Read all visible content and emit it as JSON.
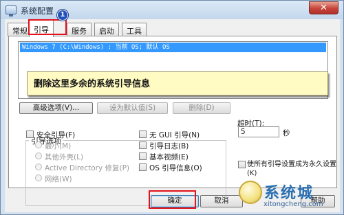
{
  "window": {
    "title": "系统配置",
    "close_glyph": "✕"
  },
  "tabs": [
    {
      "label": "常规",
      "active": false
    },
    {
      "label": "引导",
      "active": true
    },
    {
      "label": "服务",
      "active": false
    },
    {
      "label": "启动",
      "active": false
    },
    {
      "label": "工具",
      "active": false
    }
  ],
  "badge": "1",
  "os_list": {
    "items": [
      "Windows 7 (C:\\Windows) : 当前 OS; 默认 OS"
    ]
  },
  "callout": "删除这里多余的系统引导信息",
  "action_buttons": {
    "advanced": "高级选项(V)...",
    "set_default": "设为默认值(S)",
    "delete": "删除(D)"
  },
  "boot_options": {
    "legend": "引导选项",
    "safe_boot": "安全引导(F)",
    "minimal": "最小(M)",
    "alternate_shell": "其他外壳(L)",
    "active_directory": "Active Directory 修复(P)",
    "network": "网络(W)",
    "no_gui": "无 GUI 引导(N)",
    "boot_log": "引导日志(B)",
    "base_video": "基本视频(E)",
    "os_boot_info": "OS 引导信息(O)"
  },
  "timeout": {
    "label": "超时(T):",
    "value": "5",
    "unit": "秒"
  },
  "make_permanent": "使所有引导设置成为永久设置(K)",
  "dialog_buttons": {
    "ok": "确定",
    "cancel": "取消",
    "help": "帮助"
  },
  "watermark": {
    "brand": "系统城",
    "url": "xitongcheng.com"
  },
  "colors": {
    "highlight": "#3399ff",
    "annotation_red": "#e3111c",
    "callout_bg": "#fffbc2",
    "badge": "#2251b8"
  }
}
